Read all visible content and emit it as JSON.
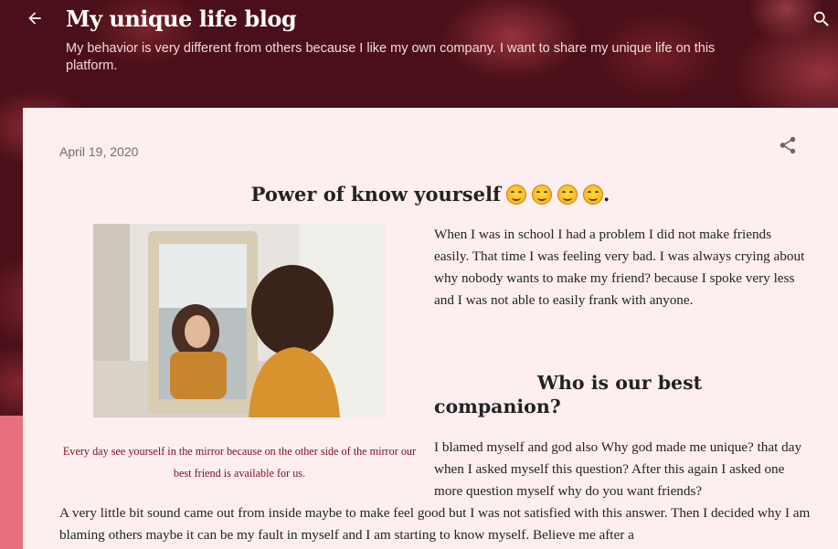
{
  "header": {
    "title": "My unique life blog",
    "description": "My behavior is very different from others because I like my own company. I want to share my unique life on this platform."
  },
  "post": {
    "date": "April 19, 2020",
    "title": "Power of know yourself",
    "title_emojis": [
      "smiling-face-emoji",
      "smiling-face-emoji",
      "smiling-face-emoji",
      "smiling-face-emoji"
    ],
    "title_suffix": ".",
    "image_caption": "Every day see yourself in the mirror because on the other side of the mirror our best friend is available for us.",
    "paragraph1": "When I was in school I had a problem I did not make friends easily. That time I was feeling very bad. I was always crying about why nobody wants to make my friend? because I spoke very less and I was not able to easily frank with anyone.",
    "subheading": "Who is our best companion?",
    "paragraph2": "I  blamed myself and god also Why god made me unique? that day when I asked myself this question? After this again I asked one more question myself why do you want friends?",
    "paragraph3": "A very little bit sound came out from inside maybe to make feel good but I was not satisfied with this answer. Then I decided why I am blaming others maybe it can be my fault in myself and I am starting to know myself. Believe me after a"
  },
  "icons": {
    "back": "arrow-left-icon",
    "search": "search-icon",
    "share": "share-icon"
  },
  "colors": {
    "header_bg": "#4a0f18",
    "card_bg": "#fdeff0",
    "caption_text": "#7a0f1a",
    "accent_pink": "#e6707c"
  }
}
